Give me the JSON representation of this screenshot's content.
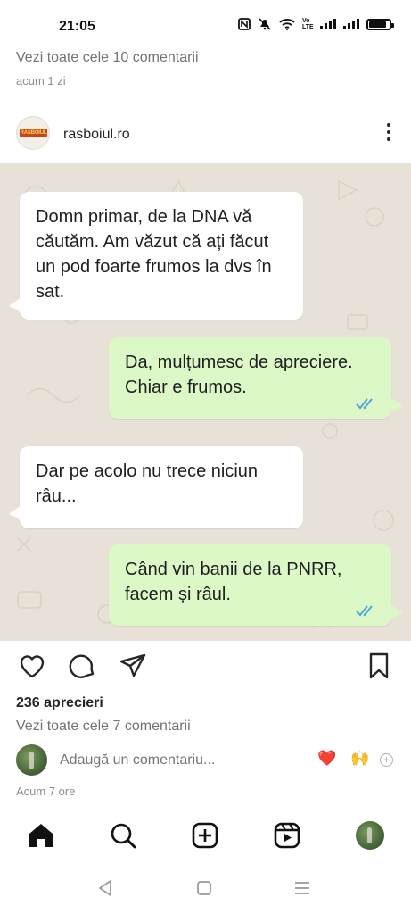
{
  "status_bar": {
    "time": "21:05",
    "icons": [
      "nfc-icon",
      "mute-vibrate-icon",
      "wifi-icon",
      "volte-icon",
      "signal-icon",
      "signal-icon",
      "battery-icon"
    ],
    "volte_text": "Vo LTE"
  },
  "previous_post": {
    "view_comments": "Vezi toate cele 10 comentarii",
    "time": "acum 1 zi"
  },
  "post": {
    "username": "rasboiul.ro",
    "avatar_text": "RASBOIUL",
    "chat": [
      {
        "side": "in",
        "text": "Domn primar, de la DNA vă căutăm. Am văzut că ați făcut un pod foarte frumos la dvs în sat."
      },
      {
        "side": "out",
        "text": "Da, mulțumesc de apreciere. Chiar e frumos."
      },
      {
        "side": "in",
        "text": "Dar pe acolo nu trece niciun râu..."
      },
      {
        "side": "out",
        "text": "Când vin banii de la PNRR, facem și râul."
      }
    ],
    "likes": "236 aprecieri",
    "view_comments": "Vezi toate cele 7 comentarii",
    "comment_placeholder": "Adaugă un comentariu...",
    "quick_reactions": [
      "❤️",
      "🙌"
    ],
    "time": "Acum 7 ore"
  },
  "colors": {
    "outgoing_bubble": "#dcf8c6",
    "incoming_bubble": "#ffffff",
    "chat_background": "#e8e1d7",
    "read_ticks": "#4fa9d6"
  }
}
